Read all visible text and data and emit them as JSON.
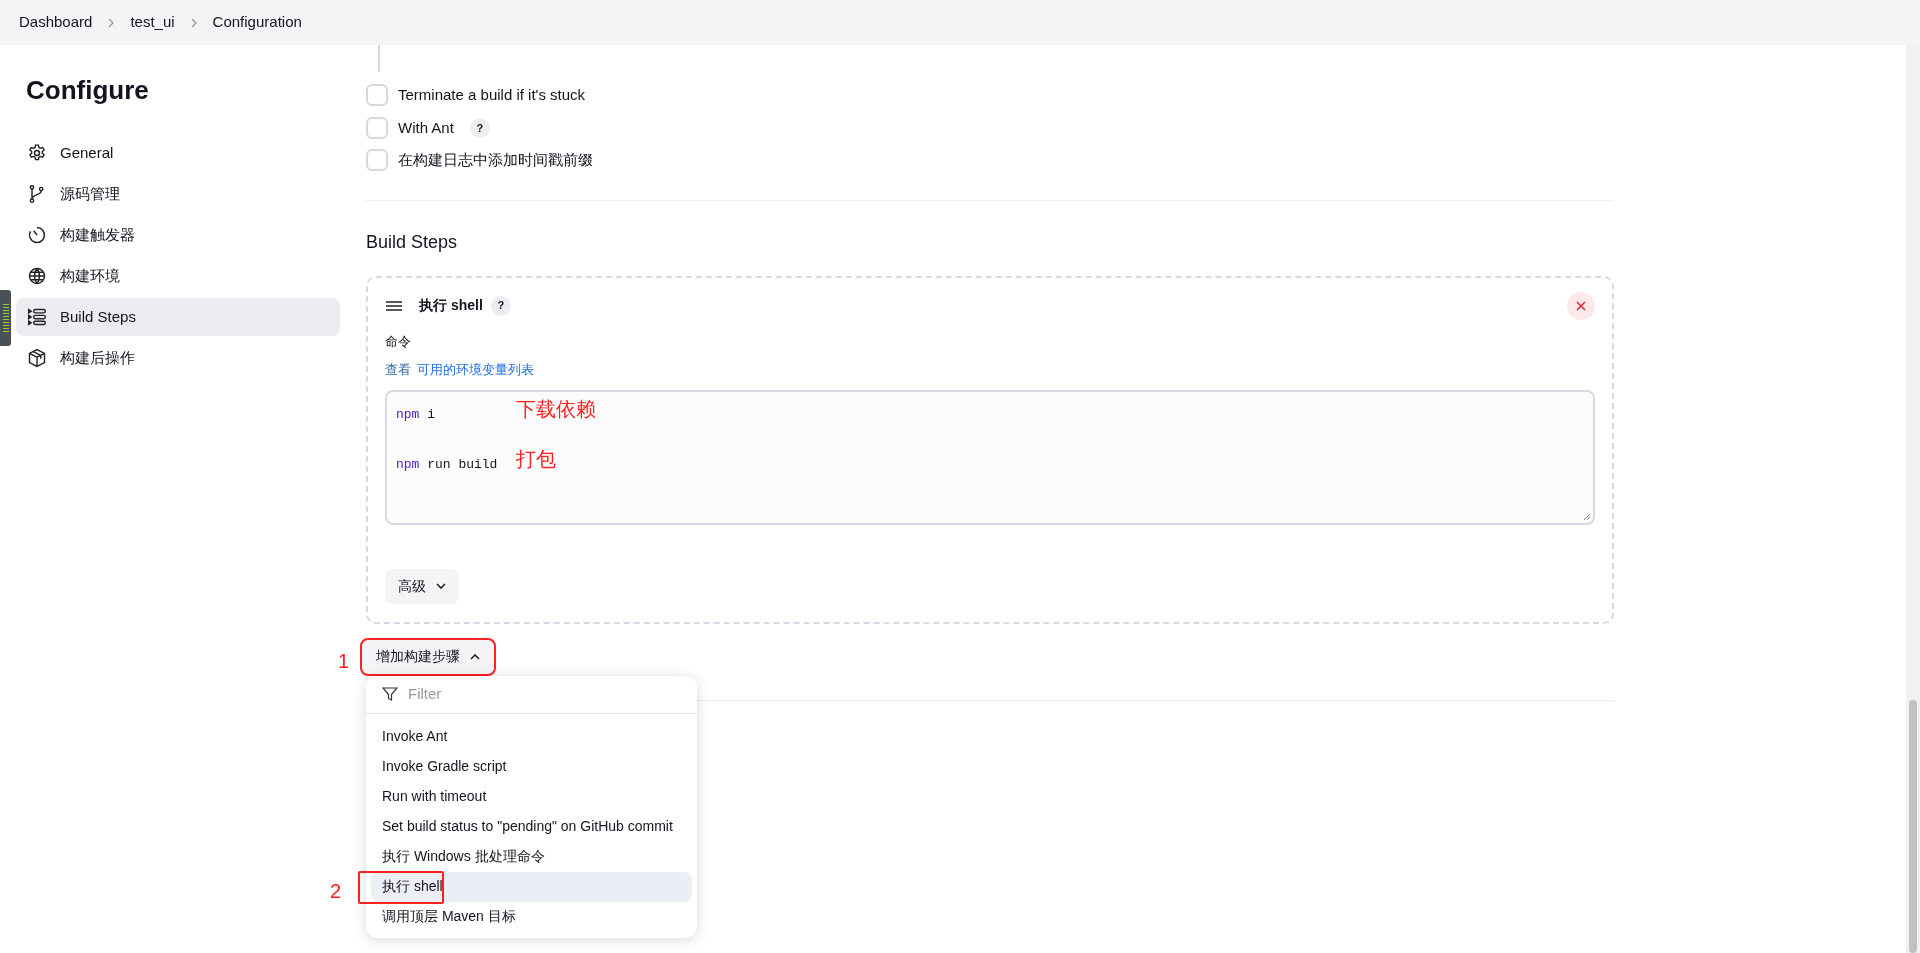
{
  "breadcrumbs": [
    {
      "label": "Dashboard"
    },
    {
      "label": "test_ui"
    },
    {
      "label": "Configuration"
    }
  ],
  "sidebar": {
    "title": "Configure",
    "items": [
      {
        "label": "General",
        "kind": "gear",
        "selected": false
      },
      {
        "label": "源码管理",
        "kind": "branch",
        "selected": false
      },
      {
        "label": "构建触发器",
        "kind": "timer",
        "selected": false
      },
      {
        "label": "构建环境",
        "kind": "globe",
        "selected": false
      },
      {
        "label": "Build Steps",
        "kind": "steps",
        "selected": true
      },
      {
        "label": "构建后操作",
        "kind": "package",
        "selected": false
      }
    ]
  },
  "options": [
    {
      "label": "Terminate a build if it's stuck",
      "checked": false
    },
    {
      "label": "With Ant",
      "checked": false,
      "help": "?"
    },
    {
      "label": "在构建日志中添加时间戳前缀",
      "checked": false
    }
  ],
  "section_title": "Build Steps",
  "build_step": {
    "title": "执行 shell",
    "help": "?",
    "field_label": "命令",
    "hint_prefix": "查看",
    "hint_link": "可用的环境变量列表",
    "command_lines": [
      {
        "keyword": "npm",
        "args": "i",
        "note": "下载依赖"
      },
      {
        "keyword": "npm",
        "args": "run build",
        "note": "打包"
      }
    ],
    "advanced_button": "高级"
  },
  "add_step": {
    "label": "增加构建步骤",
    "expanded": true,
    "annotation": "1"
  },
  "menu": {
    "filter_placeholder": "Filter",
    "items": [
      {
        "label": "Invoke Ant",
        "selected": false
      },
      {
        "label": "Invoke Gradle script",
        "selected": false
      },
      {
        "label": "Run with timeout",
        "selected": false
      },
      {
        "label": "Set build status to \"pending\" on GitHub commit",
        "selected": false
      },
      {
        "label": "执行 Windows 批处理命令",
        "selected": false
      },
      {
        "label": "执行 shell",
        "selected": true,
        "annotation": "2"
      },
      {
        "label": "调用顶层 Maven 目标",
        "selected": false
      }
    ]
  }
}
